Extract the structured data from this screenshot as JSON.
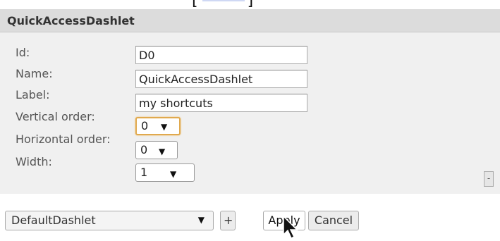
{
  "panel": {
    "title": "QuickAccessDashlet"
  },
  "form": {
    "id": {
      "label": "Id:",
      "value": "D0"
    },
    "name": {
      "label": "Name:",
      "value": "QuickAccessDashlet"
    },
    "label": {
      "label": "Label:",
      "value": "my shortcuts"
    },
    "vertical_order": {
      "label": "Vertical order:",
      "value": "0"
    },
    "horizontal_order": {
      "label": "Horizontal order:",
      "value": "0"
    },
    "width": {
      "label": "Width:",
      "value": "1"
    }
  },
  "collapse_button": {
    "label": "-"
  },
  "footer": {
    "dashlet_type_select": "DefaultDashlet",
    "add_label": "+",
    "apply_label": "Apply",
    "cancel_label": "Cancel"
  },
  "icons": {
    "dropdown_arrow": "▼",
    "cursor": "arrow-cursor-icon"
  },
  "colors": {
    "focus_border": "#e0a94e",
    "panel_header": "#dcdcdc",
    "panel_body": "#f0f0f0"
  }
}
